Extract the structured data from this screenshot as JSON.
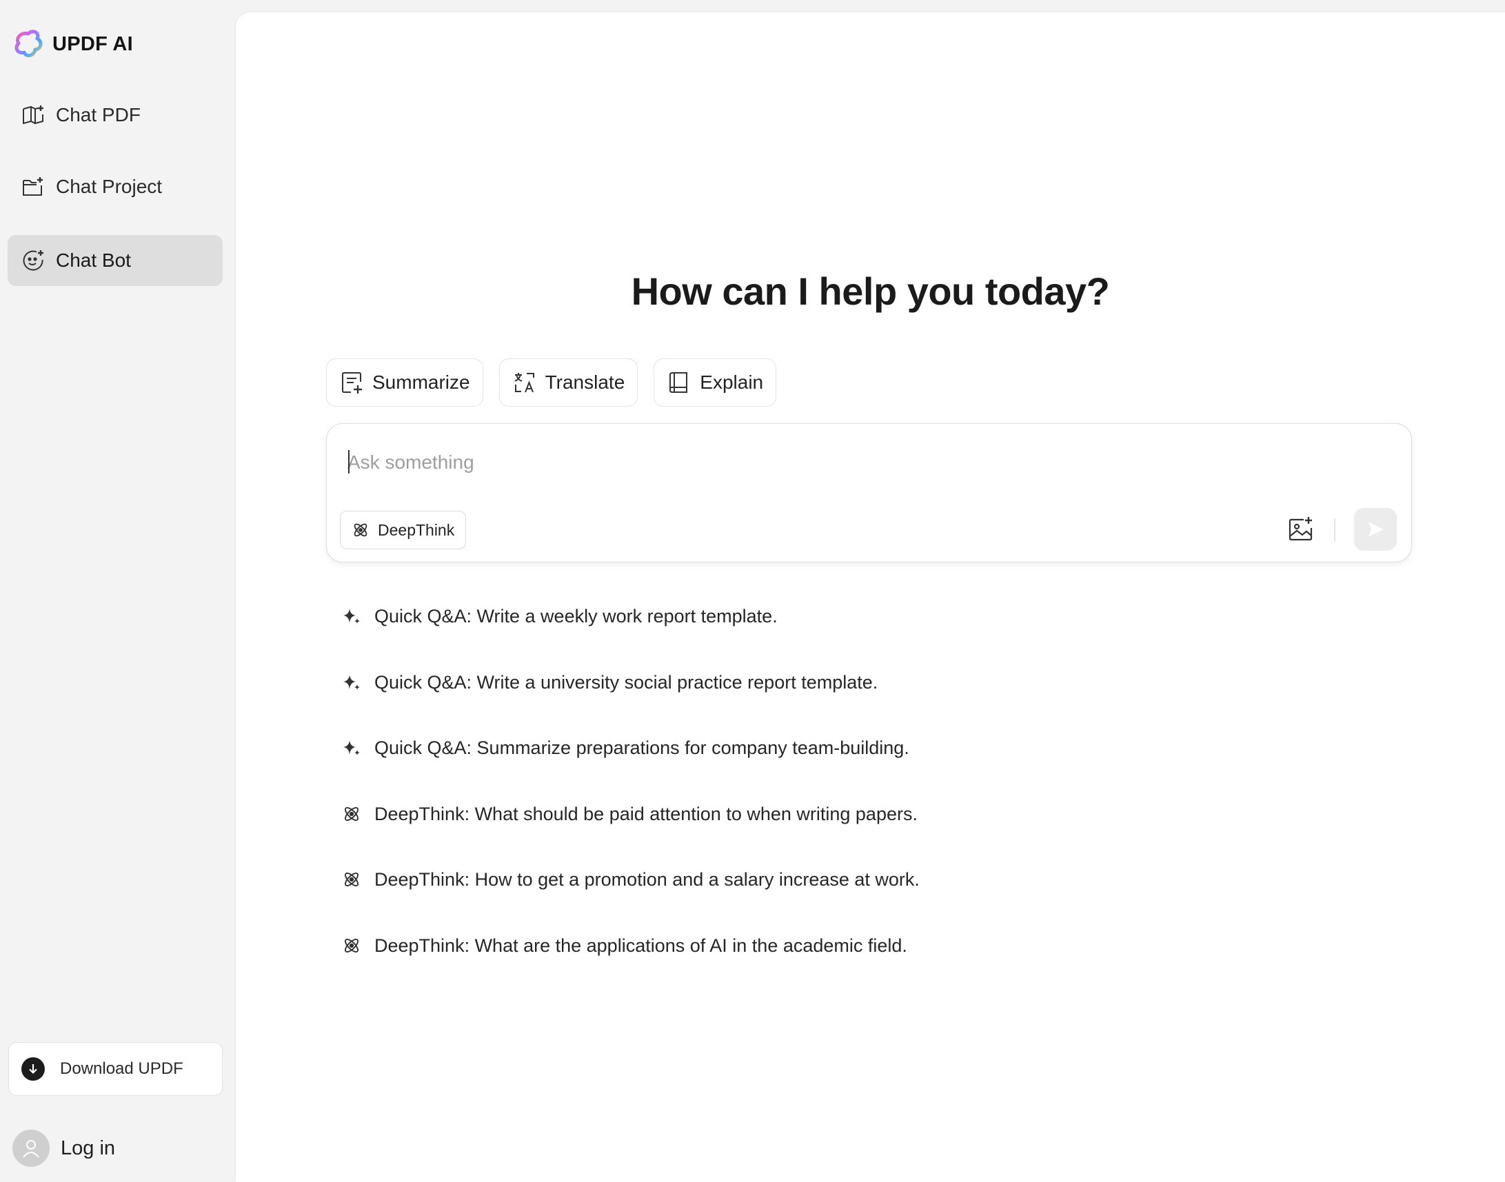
{
  "brand": {
    "name": "UPDF AI"
  },
  "nav": [
    {
      "label": "Chat PDF",
      "icon": "book-sparkle-icon"
    },
    {
      "label": "Chat Project",
      "icon": "folder-sparkle-icon"
    },
    {
      "label": "Chat Bot",
      "icon": "bot-face-icon",
      "active": true
    }
  ],
  "download": {
    "label": "Download UPDF"
  },
  "login": {
    "label": "Log in"
  },
  "main": {
    "headline": "How can I help you today?",
    "chips": [
      {
        "label": "Summarize",
        "icon": "summarize-icon"
      },
      {
        "label": "Translate",
        "icon": "translate-icon"
      },
      {
        "label": "Explain",
        "icon": "book-icon"
      }
    ],
    "composer": {
      "placeholder": "Ask something",
      "value": "",
      "deepthink_label": "DeepThink"
    },
    "suggestions": [
      {
        "type": "quick",
        "icon": "sparkle-icon",
        "label": "Quick Q&A: Write a weekly work report template."
      },
      {
        "type": "quick",
        "icon": "sparkle-icon",
        "label": "Quick Q&A: Write a university social practice report template."
      },
      {
        "type": "quick",
        "icon": "sparkle-icon",
        "label": "Quick Q&A: Summarize preparations for company team-building."
      },
      {
        "type": "deep",
        "icon": "atom-icon",
        "label": "DeepThink: What should be paid attention to when writing papers."
      },
      {
        "type": "deep",
        "icon": "atom-icon",
        "label": "DeepThink: How to get a promotion and a salary increase at work."
      },
      {
        "type": "deep",
        "icon": "atom-icon",
        "label": "DeepThink: What are the applications of AI in the academic field."
      }
    ]
  },
  "colors": {
    "sidebar_bg": "#f3f3f3",
    "active_nav_bg": "#dedede",
    "panel_bg": "#ffffff",
    "text_primary": "#1b1b1b",
    "placeholder": "#9e9e9e"
  }
}
